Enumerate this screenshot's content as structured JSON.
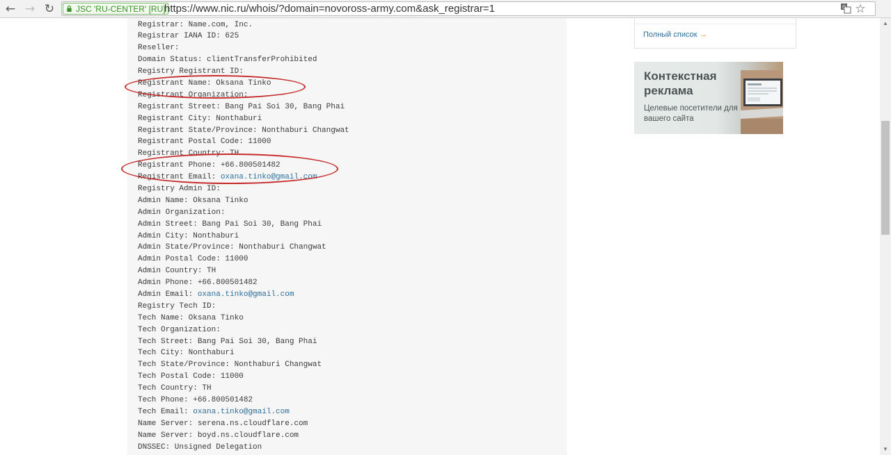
{
  "browser": {
    "back_icon": "arrow-left-icon",
    "forward_icon": "arrow-right-icon",
    "reload_icon": "reload-icon",
    "security_badge": "JSC 'RU-CENTER' [RU]",
    "url": "https://www.nic.ru/whois/?domain=novoross-army.com&ask_registrar=1",
    "right_icons": [
      "translate-icon",
      "star-icon"
    ]
  },
  "whois": {
    "lines": [
      "Registrar: Name.com, Inc.",
      "Registrar IANA ID: 625",
      "Reseller:",
      "Domain Status: clientTransferProhibited",
      "Registry Registrant ID:",
      "Registrant Name: Oksana Tinko",
      "Registrant Organization:",
      "Registrant Street: Bang Pai Soi 30, Bang Phai",
      "Registrant City: Nonthaburi",
      "Registrant State/Province: Nonthaburi Changwat",
      "Registrant Postal Code: 11000",
      "Registrant Country: TH",
      "Registrant Phone: +66.800501482",
      "Registrant Email: ",
      "Registry Admin ID:",
      "Admin Name: Oksana Tinko",
      "Admin Organization:",
      "Admin Street: Bang Pai Soi 30, Bang Phai",
      "Admin City: Nonthaburi",
      "Admin State/Province: Nonthaburi Changwat",
      "Admin Postal Code: 11000",
      "Admin Country: TH",
      "Admin Phone: +66.800501482",
      "Admin Email: ",
      "Registry Tech ID:",
      "Tech Name: Oksana Tinko",
      "Tech Organization:",
      "Tech Street: Bang Pai Soi 30, Bang Phai",
      "Tech City: Nonthaburi",
      "Tech State/Province: Nonthaburi Changwat",
      "Tech Postal Code: 11000",
      "Tech Country: TH",
      "Tech Phone: +66.800501482",
      "Tech Email: ",
      "Name Server: serena.ns.cloudflare.com",
      "Name Server: boyd.ns.cloudflare.com",
      "DNSSEC: Unsigned Delegation"
    ],
    "email_links": {
      "13": "oxana.tinko@gmail.com",
      "23": "oxana.tinko@gmail.com",
      "33": "oxana.tinko@gmail.com"
    },
    "link_color": "#2d6e9a"
  },
  "annotations": {
    "color": "#c62a2a"
  },
  "sidebar": {
    "full_list_label": "Полный список",
    "full_list_arrow": "→"
  },
  "ad": {
    "title": "Контекстная реклама",
    "subtitle": "Целевые посетители для вашего сайта"
  }
}
